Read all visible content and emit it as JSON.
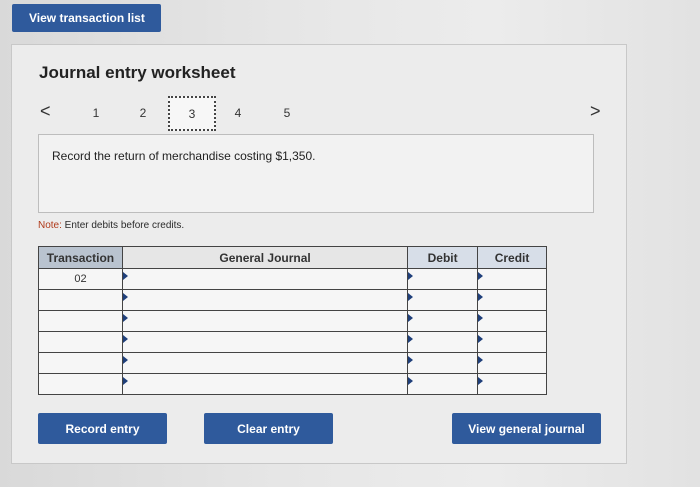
{
  "top_button": {
    "label": "View transaction list"
  },
  "worksheet": {
    "title": "Journal entry worksheet",
    "pager": {
      "prev_icon": "<",
      "next_icon": ">",
      "pages": [
        "1",
        "2",
        "3",
        "4",
        "5"
      ],
      "current": "3"
    },
    "instruction": "Record the return of merchandise costing $1,350.",
    "note_label": "Note:",
    "note_text": " Enter debits before credits.",
    "table": {
      "headers": {
        "transaction": "Transaction",
        "general_journal": "General Journal",
        "debit": "Debit",
        "credit": "Credit"
      },
      "rows": [
        {
          "transaction": "02",
          "general_journal": "",
          "debit": "",
          "credit": ""
        },
        {
          "transaction": "",
          "general_journal": "",
          "debit": "",
          "credit": ""
        },
        {
          "transaction": "",
          "general_journal": "",
          "debit": "",
          "credit": ""
        },
        {
          "transaction": "",
          "general_journal": "",
          "debit": "",
          "credit": ""
        },
        {
          "transaction": "",
          "general_journal": "",
          "debit": "",
          "credit": ""
        },
        {
          "transaction": "",
          "general_journal": "",
          "debit": "",
          "credit": ""
        }
      ]
    },
    "buttons": {
      "record": "Record entry",
      "clear": "Clear entry",
      "view_general_journal": "View general journal"
    }
  },
  "colors": {
    "primary_button": "#2f5a9c",
    "header_transaction": "#b9c3cf",
    "header_amount": "#d7dee8"
  }
}
